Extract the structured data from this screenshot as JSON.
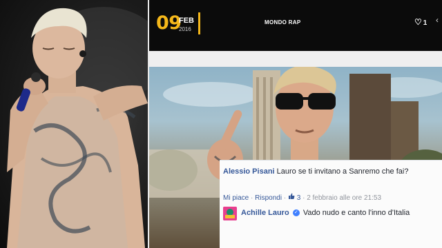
{
  "header": {
    "day": "09",
    "month": "FEB",
    "year": "2016",
    "category": "MONDO RAP",
    "likes": "1"
  },
  "comments": [
    {
      "author": "Alessio Pisani",
      "text": "Lauro se ti invitano a Sanremo che fai?",
      "actions": {
        "like": "Mi piace",
        "reply": "Rispondi",
        "like_count": "3",
        "date": "2 febbraio alle ore 21:53"
      }
    },
    {
      "author": "Achille Lauro",
      "verified": true,
      "text": "Vado nudo e canto l'inno d'Italia"
    }
  ],
  "icons": {
    "heart": "heart-icon",
    "thumbs_up": "thumbs-up-icon",
    "verified": "verified-badge-icon"
  },
  "colors": {
    "accent": "#f4b71a",
    "facebook_link": "#365899",
    "topbar": "#0b0b0b"
  }
}
